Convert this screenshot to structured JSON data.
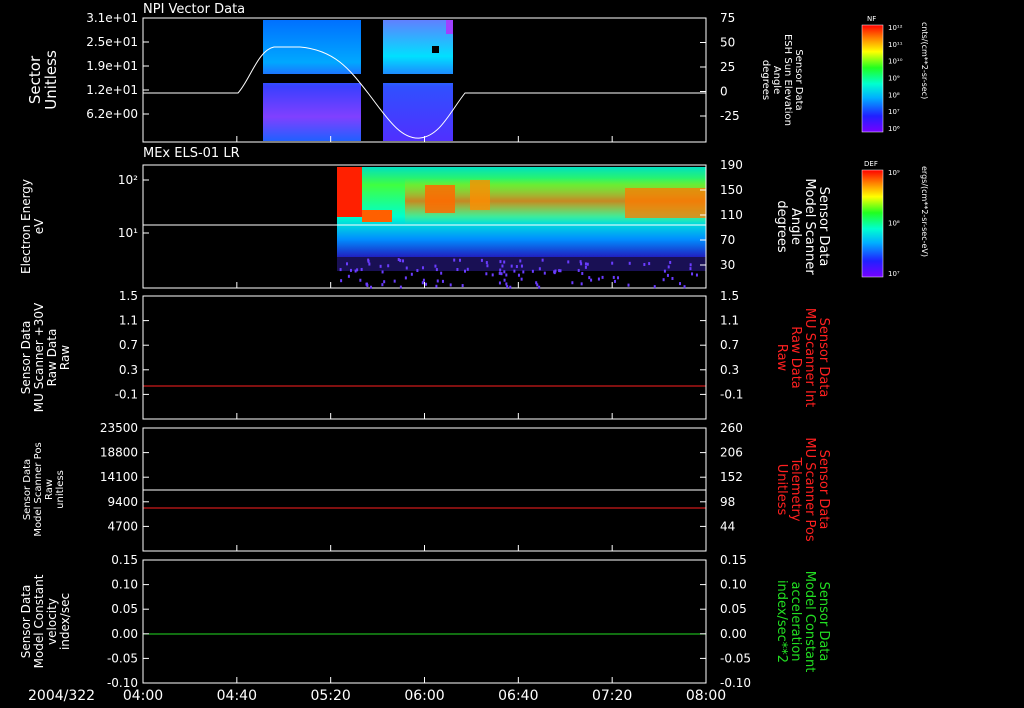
{
  "date_label": "2004/322",
  "time_ticks": [
    "04:00",
    "04:40",
    "05:20",
    "06:00",
    "06:40",
    "07:20",
    "08:00"
  ],
  "panels": [
    {
      "title": "NPI Vector Data",
      "left_label": [
        "Sector",
        "Unitless"
      ],
      "left_ticks": [
        "3.1e+01",
        "2.5e+01",
        "1.9e+01",
        "1.2e+01",
        "6.2e+00"
      ],
      "right_label": [
        "Sensor Data",
        "ESH Sun Elevation",
        "Angle",
        "degrees"
      ],
      "right_ticks": [
        "75",
        "50",
        "25",
        "0",
        "-25"
      ],
      "colorbar": {
        "tag": "NF",
        "labels": [
          "10¹²",
          "10¹¹",
          "10¹⁰",
          "10⁹",
          "10⁸",
          "10⁷",
          "10⁶"
        ],
        "unit": "cnts/(cm**2-sr-sec)"
      }
    },
    {
      "title": "MEx ELS-01 LR",
      "left_label": [
        "Electron Energy",
        "eV"
      ],
      "left_ticks": [
        "10²",
        "10¹"
      ],
      "right_label": [
        "Sensor Data",
        "Model Scanner",
        "Angle",
        "degrees"
      ],
      "right_ticks": [
        "190",
        "150",
        "110",
        "70",
        "30"
      ],
      "colorbar": {
        "tag": "DEF",
        "labels": [
          "10⁹",
          "10⁸",
          "10⁷"
        ],
        "unit": "ergs/(cm**2-sr-sec-eV)"
      }
    },
    {
      "title": "",
      "left_label": [
        "Sensor Data",
        "MU Scanner +30V",
        "Raw Data",
        "Raw"
      ],
      "left_ticks": [
        "1.5",
        "1.1",
        "0.7",
        "0.3",
        "-0.1"
      ],
      "right_label": [
        "Sensor Data",
        "MU Scanner Int",
        "Raw Data",
        "Raw"
      ],
      "right_ticks": [
        "1.5",
        "1.1",
        "0.7",
        "0.3",
        "-0.1"
      ]
    },
    {
      "title": "",
      "left_label": [
        "Sensor Data",
        "Model Scanner Pos",
        "Raw",
        "unitless"
      ],
      "left_ticks": [
        "23500",
        "18800",
        "14100",
        "9400",
        "4700"
      ],
      "right_label": [
        "Sensor Data",
        "MU Scanner Pos",
        "Telemetry",
        "Unitless"
      ],
      "right_ticks": [
        "260",
        "206",
        "152",
        "98",
        "44"
      ]
    },
    {
      "title": "",
      "left_label": [
        "Sensor Data",
        "Model Constant",
        "velocity",
        "index/sec"
      ],
      "left_ticks": [
        "0.15",
        "0.10",
        "0.05",
        "0.00",
        "-0.05",
        "-0.10"
      ],
      "right_label": [
        "Sensor Data",
        "Model Constant",
        "acceleration",
        "index/sec**2"
      ],
      "right_ticks": [
        "0.15",
        "0.10",
        "0.05",
        "0.00",
        "-0.05",
        "-0.10"
      ]
    }
  ],
  "colors": {
    "background": "#000000",
    "axes": "#ffffff",
    "red_trace": "#ff2020",
    "green_trace": "#22dd22"
  },
  "chart_data": [
    {
      "type": "heatmap",
      "title": "NPI Vector Data",
      "xlabel": "",
      "ylabel": "Sector Unitless",
      "x_range": [
        "04:00",
        "08:00"
      ],
      "coverage": [
        [
          "04:45",
          "05:27"
        ],
        [
          "05:35",
          "06:10"
        ]
      ],
      "overlay_line": {
        "name": "ESH Sun Elevation Angle",
        "x": [
          "04:00",
          "04:30",
          "04:45",
          "05:00",
          "05:20",
          "05:40",
          "05:58",
          "06:10",
          "06:20",
          "08:00"
        ],
        "y": [
          0,
          0,
          40,
          40,
          18,
          -25,
          -40,
          -25,
          0,
          0
        ]
      }
    },
    {
      "type": "heatmap",
      "title": "MEx ELS-01 LR",
      "ylabel": "Electron Energy eV",
      "x_range": [
        "04:00",
        "08:00"
      ],
      "coverage": [
        [
          "05:22",
          "08:00"
        ]
      ],
      "overlay_line": {
        "name": "Model Scanner Angle",
        "x": [
          "04:00",
          "08:00"
        ],
        "y": [
          90,
          90
        ]
      }
    },
    {
      "type": "line",
      "ylim": [
        -0.3,
        1.5
      ],
      "series": [
        {
          "color": "#ff2020",
          "x": [
            "04:00",
            "08:00"
          ],
          "y": [
            0.0,
            0.0
          ]
        }
      ]
    },
    {
      "type": "line",
      "ylim": [
        0,
        23500
      ],
      "series": [
        {
          "color": "#ffffff",
          "x": [
            "04:00",
            "08:00"
          ],
          "y": [
            11800,
            11800
          ]
        },
        {
          "color": "#ff2020",
          "x": [
            "04:00",
            "08:00"
          ],
          "y": [
            8300,
            8300
          ]
        }
      ]
    },
    {
      "type": "line",
      "ylim": [
        -0.1,
        0.15
      ],
      "series": [
        {
          "color": "#22dd22",
          "x": [
            "04:00",
            "08:00"
          ],
          "y": [
            0.0,
            0.0
          ]
        }
      ]
    }
  ]
}
